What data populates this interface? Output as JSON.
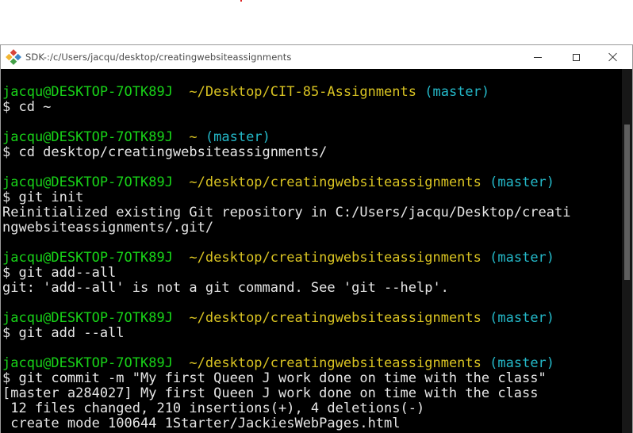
{
  "window": {
    "title": "SDK-:/c/Users/jacqu/desktop/creatingwebsiteassignments",
    "icon": "git-sdk-icon",
    "controls": {
      "minimize": "minimize-icon",
      "maximize": "maximize-icon",
      "close": "close-icon"
    }
  },
  "colors": {
    "user": "#18d318",
    "path": "#d9c322",
    "branch": "#24b9c9",
    "output": "#e6e6e6",
    "background": "#000000"
  },
  "terminal": {
    "blocks": [
      {
        "user": "jacqu@DESKTOP-7OTK89J",
        "path": "~/Desktop/CIT-85-Assignments",
        "branch": "(master)",
        "command": "$ cd ~",
        "output": []
      },
      {
        "user": "jacqu@DESKTOP-7OTK89J",
        "path": "~",
        "branch": "(master)",
        "command": "$ cd desktop/creatingwebsiteassignments/",
        "output": []
      },
      {
        "user": "jacqu@DESKTOP-7OTK89J",
        "path": "~/desktop/creatingwebsiteassignments",
        "branch": "(master)",
        "command": "$ git init",
        "output": [
          "Reinitialized existing Git repository in C:/Users/jacqu/Desktop/creati",
          "ngwebsiteassignments/.git/"
        ]
      },
      {
        "user": "jacqu@DESKTOP-7OTK89J",
        "path": "~/desktop/creatingwebsiteassignments",
        "branch": "(master)",
        "command": "$ git add--all",
        "output": [
          "git: 'add--all' is not a git command. See 'git --help'."
        ]
      },
      {
        "user": "jacqu@DESKTOP-7OTK89J",
        "path": "~/desktop/creatingwebsiteassignments",
        "branch": "(master)",
        "command": "$ git add --all",
        "output": []
      },
      {
        "user": "jacqu@DESKTOP-7OTK89J",
        "path": "~/desktop/creatingwebsiteassignments",
        "branch": "(master)",
        "command": "$ git commit -m \"My first Queen J work done on time with the class\"",
        "output": [
          "[master a284027] My first Queen J work done on time with the class",
          " 12 files changed, 210 insertions(+), 4 deletions(-)",
          " create mode 100644 1Starter/JackiesWebPages.html"
        ]
      }
    ]
  }
}
